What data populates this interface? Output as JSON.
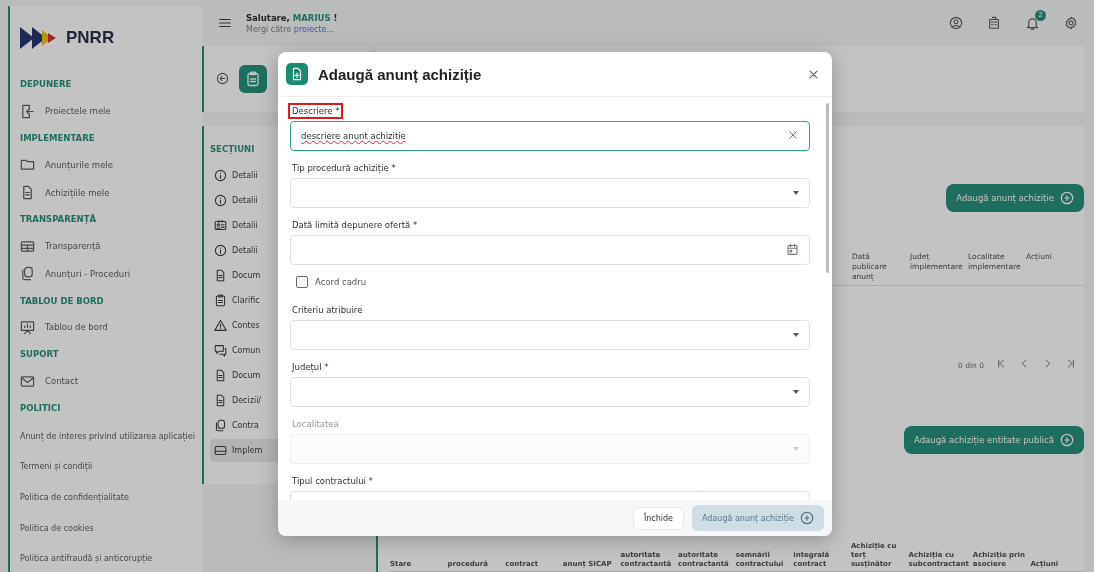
{
  "header": {
    "greeting": "Salutare,",
    "user_name": "MARIUS",
    "greeting_end": "!",
    "subtitle": "Mergi către",
    "subtitle_link": "proiecte...",
    "notification_count": "2"
  },
  "sidebar": {
    "logo": "PNRR",
    "groups": [
      {
        "title": "DEPUNERE",
        "kind": "menu",
        "items": [
          {
            "label": "Proiectele mele"
          }
        ]
      },
      {
        "title": "IMPLEMENTARE",
        "kind": "menu",
        "items": [
          {
            "label": "Anunțurile mele"
          },
          {
            "label": "Achizițiile mele"
          }
        ]
      },
      {
        "title": "TRANSPARENȚĂ",
        "kind": "menu",
        "items": [
          {
            "label": "Transparență"
          },
          {
            "label": "Anunțuri - Proceduri"
          }
        ]
      },
      {
        "title": "TABLOU DE BORD",
        "kind": "menu",
        "items": [
          {
            "label": "Tablou de bord"
          }
        ]
      },
      {
        "title": "SUPORT",
        "kind": "menu",
        "items": [
          {
            "label": "Contact"
          }
        ]
      },
      {
        "title": "POLITICI",
        "kind": "links",
        "items": [
          {
            "label": "Anunț de interes privind utilizarea aplicației"
          },
          {
            "label": "Termeni și condiții"
          },
          {
            "label": "Politica de confidențialitate"
          },
          {
            "label": "Politica de cookies"
          },
          {
            "label": "Politica antifraudă și anticorupție"
          }
        ]
      }
    ]
  },
  "sections": {
    "title": "SECȚIUNI",
    "items": [
      {
        "label": "Detalii",
        "selected": false
      },
      {
        "label": "Detalii",
        "selected": false
      },
      {
        "label": "Detalii",
        "selected": false
      },
      {
        "label": "Detalii",
        "selected": false
      },
      {
        "label": "Docum",
        "selected": false
      },
      {
        "label": "Clarific",
        "selected": false
      },
      {
        "label": "Contes",
        "selected": false
      },
      {
        "label": "Comun",
        "selected": false
      },
      {
        "label": "Docum",
        "selected": false
      },
      {
        "label": "Decizii/",
        "selected": false
      },
      {
        "label": "Contra",
        "selected": false
      },
      {
        "label": "Implem",
        "selected": true
      }
    ]
  },
  "announcements": {
    "add_button": "Adaugă anunț achiziție",
    "columns": [
      "Dată publicare anunț",
      "Județ implementare",
      "Localitate implementare",
      "Acțiuni"
    ],
    "pagination": "0 din 0"
  },
  "acquisitions": {
    "add_button": "Adaugă achiziție entitate publică",
    "columns": [
      "Stare",
      "procedură",
      "contract",
      "anunț SICAP",
      "autoritate contractantă",
      "autoritate contractantă",
      "semnării contractului",
      "integrală contract",
      "Achiziție cu terț susținător",
      "Achiziție cu subcontractant",
      "Achiziție prin asociere",
      "Acțiuni"
    ]
  },
  "dialog": {
    "title": "Adaugă anunț achiziție",
    "fields": [
      {
        "kind": "text",
        "label": "Descriere *",
        "value": "descriere anunt achizitie",
        "focused": true,
        "highlighted": true,
        "disabled": false
      },
      {
        "kind": "select",
        "label": "Tip procedură achiziție *",
        "focused": false,
        "highlighted": false,
        "disabled": false
      },
      {
        "kind": "date",
        "label": "Dată limită depunere ofertă *",
        "focused": false,
        "highlighted": false,
        "disabled": false
      },
      {
        "kind": "checkbox",
        "label": "Acord cadru",
        "checked": false
      },
      {
        "kind": "select",
        "label": "Criteriu atribuire",
        "focused": false,
        "highlighted": false,
        "disabled": false
      },
      {
        "kind": "select",
        "label": "Județul *",
        "focused": false,
        "highlighted": false,
        "disabled": false
      },
      {
        "kind": "select",
        "label": "Localitatea",
        "focused": false,
        "highlighted": false,
        "disabled": true
      },
      {
        "kind": "select",
        "label": "Tipul contractului *",
        "focused": false,
        "highlighted": false,
        "disabled": false
      }
    ],
    "buttons": [
      {
        "kind": "secondary",
        "label": "Închide",
        "disabled": false
      },
      {
        "kind": "primary",
        "label": "Adaugă anunț achiziție",
        "disabled": true
      }
    ]
  }
}
